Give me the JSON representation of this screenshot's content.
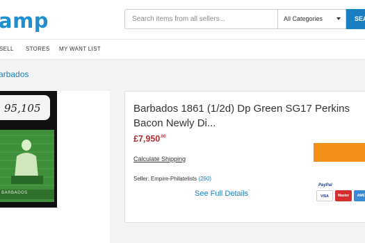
{
  "header": {
    "logo": "amp",
    "search_placeholder": "Search items from all sellers...",
    "category": "All Categories",
    "search_button": "SEA"
  },
  "nav": {
    "items": [
      "SELL",
      "STORES",
      "MY WANT LIST"
    ]
  },
  "breadcrumb": "arbados",
  "stamp": {
    "number": "95,105",
    "caption": "BARBADOS"
  },
  "listing": {
    "title": "Barbados 1861 (1/2d) Dp Green SG17 Perkins Bacon Newly Di...",
    "price_main": "£7,950",
    "price_cents": ".00",
    "calculate_shipping": "Calculate Shipping",
    "seller_label": "Seller: Empire-Philatelists",
    "seller_count": "(290)",
    "full_details": "See Full Details"
  },
  "payment": {
    "paypal": "PayPal",
    "cards": [
      "VISA",
      "Master",
      "AMEX"
    ]
  },
  "colors": {
    "brand_blue": "#1a7fc1",
    "price_red": "#b03030",
    "buy_orange": "#f39019"
  }
}
